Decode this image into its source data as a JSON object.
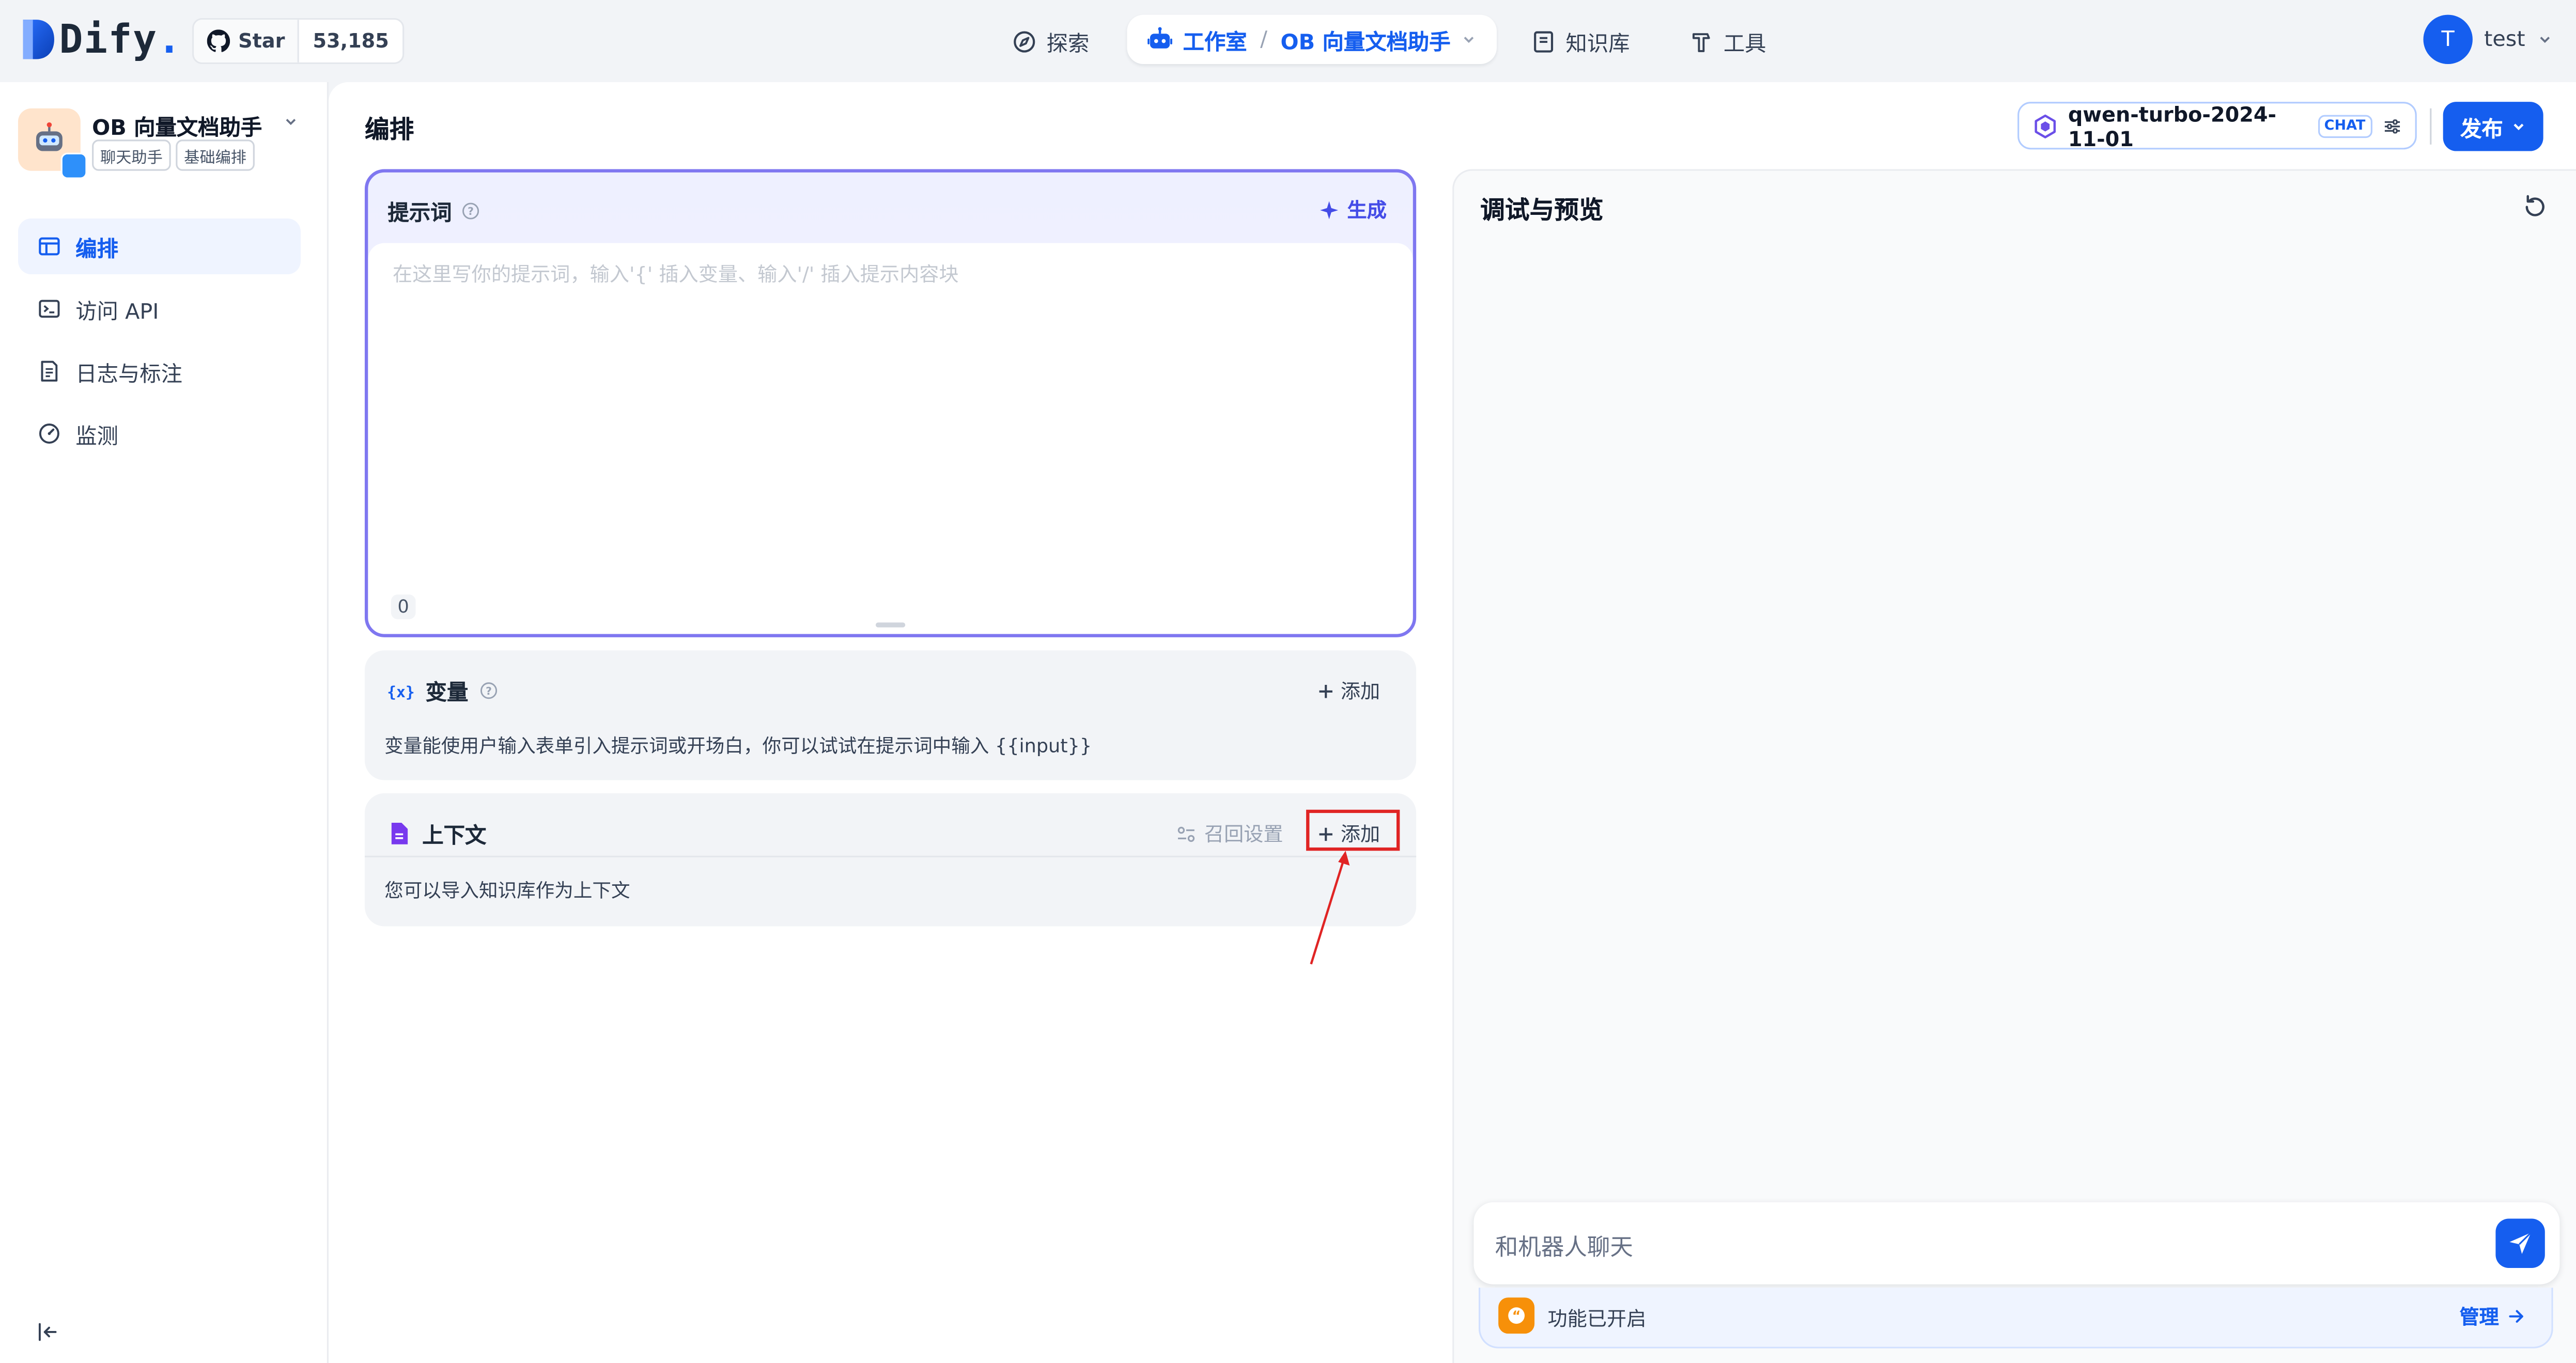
{
  "header": {
    "logo_text": "Dify",
    "logo_dot": ".",
    "github_star_label": "Star",
    "github_star_count": "53,185",
    "nav": {
      "explore": "探索",
      "studio": "工作室",
      "current_app": "OB 向量文档助手",
      "knowledge": "知识库",
      "tools": "工具"
    },
    "user": {
      "initial": "T",
      "name": "test"
    }
  },
  "sidebar": {
    "app_name": "OB 向量文档助手",
    "tags": [
      "聊天助手",
      "基础编排"
    ],
    "items": [
      {
        "label": "编排",
        "icon": "layout-icon"
      },
      {
        "label": "访问 API",
        "icon": "terminal-icon"
      },
      {
        "label": "日志与标注",
        "icon": "file-list-icon"
      },
      {
        "label": "监测",
        "icon": "dashboard-icon"
      }
    ]
  },
  "main": {
    "title": "编排",
    "model": {
      "name": "qwen-turbo-2024-11-01",
      "mode_badge": "CHAT"
    },
    "publish_label": "发布",
    "prompt": {
      "title": "提示词",
      "generate_label": "生成",
      "placeholder": "在这里写你的提示词，输入'{' 插入变量、输入'/' 插入提示内容块",
      "char_count": "0"
    },
    "variables": {
      "title": "变量",
      "add_label": "添加",
      "description": "变量能使用户输入表单引入提示词或开场白，你可以试试在提示词中输入 {{input}}"
    },
    "context": {
      "title": "上下文",
      "recall_label": "召回设置",
      "add_label": "添加",
      "description": "您可以导入知识库作为上下文"
    }
  },
  "debug_panel": {
    "title": "调试与预览",
    "chat_placeholder": "和机器人聊天",
    "features_label": "功能已开启",
    "manage_label": "管理"
  },
  "colors": {
    "primary": "#155eef",
    "highlight": "#e02424",
    "prompt_border": "#7f77f0"
  }
}
